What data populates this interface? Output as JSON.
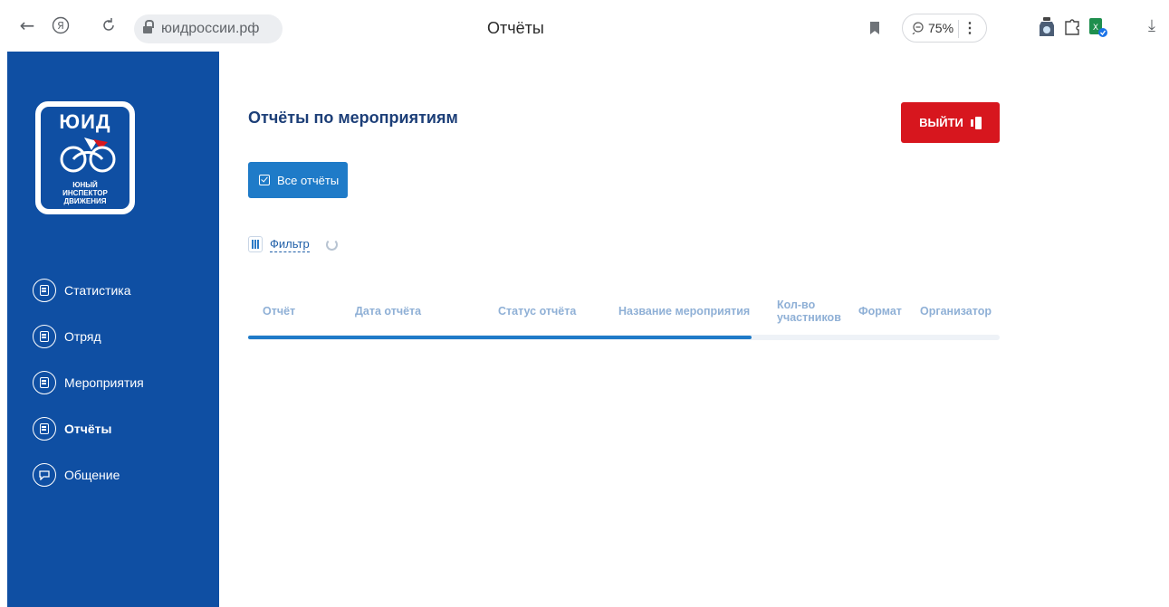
{
  "browser": {
    "url": "юидроссии.рф",
    "tab_title": "Отчёты",
    "zoom": "75%",
    "more_label": "⋮"
  },
  "sidebar": {
    "logo": {
      "title": "ЮИД",
      "subtitle": "ЮНЫЙ\nИНСПЕКТОР\nДВИЖЕНИЯ"
    },
    "items": [
      {
        "label": "Статистика",
        "icon": "statistics-icon",
        "active": false
      },
      {
        "label": "Отряд",
        "icon": "team-icon",
        "active": false
      },
      {
        "label": "Мероприятия",
        "icon": "events-icon",
        "active": false
      },
      {
        "label": "Отчёты",
        "icon": "reports-icon",
        "active": true
      },
      {
        "label": "Общение",
        "icon": "chat-icon",
        "active": false
      }
    ]
  },
  "main": {
    "title": "Отчёты по мероприятиям",
    "logout_label": "ВЫЙТИ",
    "all_reports_label": "Все отчёты",
    "filter_label": "Фильтр",
    "columns": [
      "Отчёт",
      "Дата отчёта",
      "Статус отчёта",
      "Название мероприятия",
      "Кол-во\nучастников",
      "Формат",
      "Организатор"
    ],
    "scroll_progress": 0.67
  },
  "colors": {
    "sidebar": "#0f4fa3",
    "primary": "#1f7bc8",
    "danger": "#d7161e",
    "header_text": "#8fb0d6"
  }
}
